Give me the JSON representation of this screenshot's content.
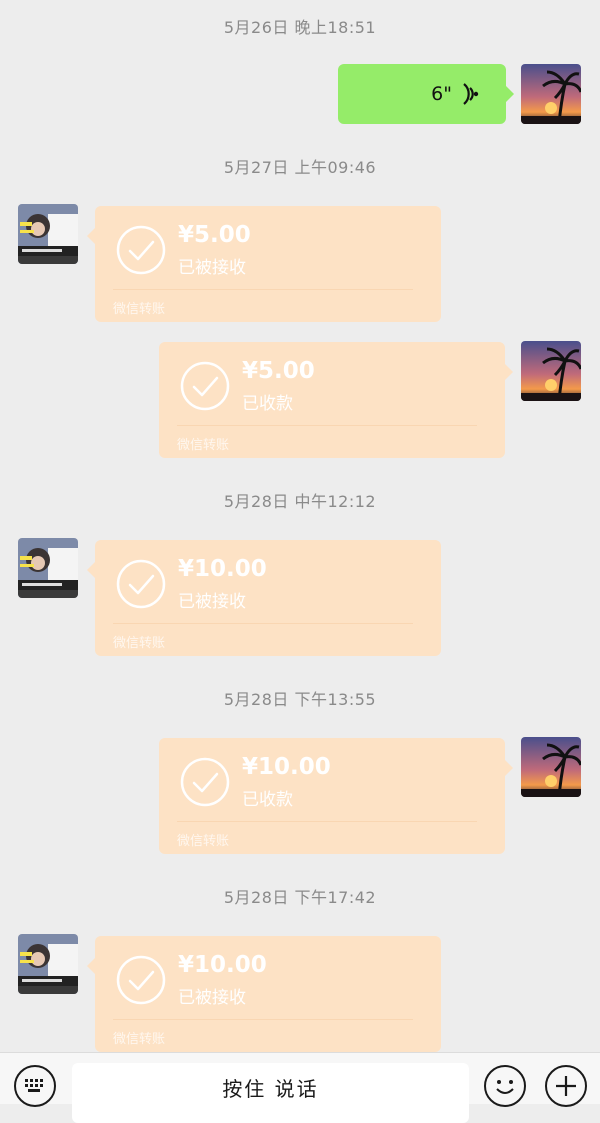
{
  "colors": {
    "background": "#ededed",
    "voice_bubble": "#95ec69",
    "transfer_card": "#fde2c5"
  },
  "messages": [
    {
      "timestamp": "5月26日 晚上18:51"
    },
    {
      "voice": {
        "duration": "6\""
      }
    },
    {
      "timestamp": "5月27日 上午09:46"
    },
    {
      "transfer": {
        "amount": "¥5.00",
        "status": "已被接收",
        "footer": "微信转账"
      }
    },
    {
      "transfer": {
        "amount": "¥5.00",
        "status": "已收款",
        "footer": "微信转账"
      }
    },
    {
      "timestamp": "5月28日 中午12:12"
    },
    {
      "transfer": {
        "amount": "¥10.00",
        "status": "已被接收",
        "footer": "微信转账"
      }
    },
    {
      "timestamp": "5月28日 下午13:55"
    },
    {
      "transfer": {
        "amount": "¥10.00",
        "status": "已收款",
        "footer": "微信转账"
      }
    },
    {
      "timestamp": "5月28日 下午17:42"
    },
    {
      "transfer": {
        "amount": "¥10.00",
        "status": "已被接收",
        "footer": "微信转账"
      }
    }
  ],
  "input_bar": {
    "hold_to_talk_label": "按住 说话",
    "icons": [
      "keyboard-icon",
      "emoji-icon",
      "plus-icon"
    ]
  }
}
